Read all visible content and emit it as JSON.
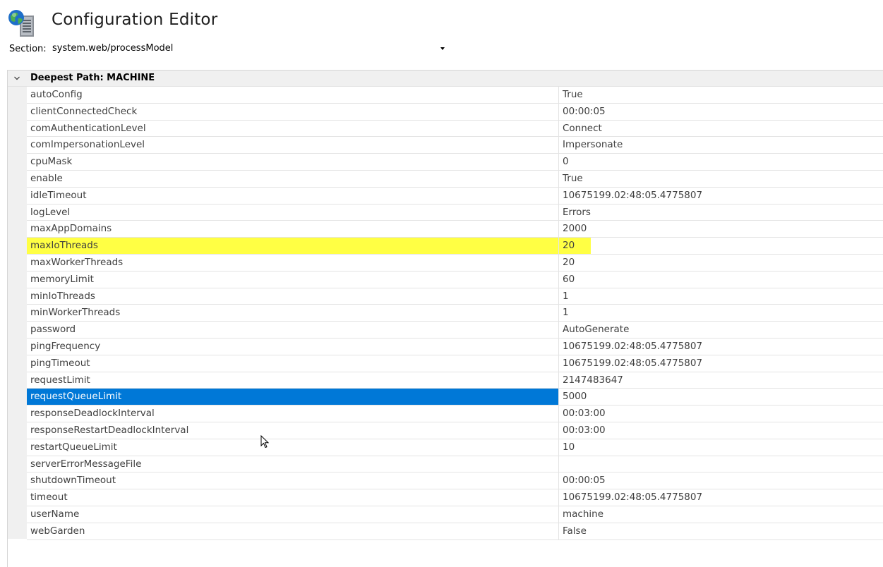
{
  "header": {
    "title": "Configuration Editor",
    "app_icon": "globe-server-icon"
  },
  "section": {
    "label": "Section:",
    "value": "system.web/processModel"
  },
  "group": {
    "title": "Deepest Path: MACHINE",
    "expanded": true
  },
  "colors": {
    "highlight": "#ffff44",
    "selection": "#0078d7"
  },
  "rows": [
    {
      "name": "autoConfig",
      "value": "True"
    },
    {
      "name": "clientConnectedCheck",
      "value": "00:00:05"
    },
    {
      "name": "comAuthenticationLevel",
      "value": "Connect"
    },
    {
      "name": "comImpersonationLevel",
      "value": "Impersonate"
    },
    {
      "name": "cpuMask",
      "value": "0"
    },
    {
      "name": "enable",
      "value": "True"
    },
    {
      "name": "idleTimeout",
      "value": "10675199.02:48:05.4775807"
    },
    {
      "name": "logLevel",
      "value": "Errors"
    },
    {
      "name": "maxAppDomains",
      "value": "2000"
    },
    {
      "name": "maxIoThreads",
      "value": "20",
      "state": "highlight"
    },
    {
      "name": "maxWorkerThreads",
      "value": "20"
    },
    {
      "name": "memoryLimit",
      "value": "60"
    },
    {
      "name": "minIoThreads",
      "value": "1"
    },
    {
      "name": "minWorkerThreads",
      "value": "1"
    },
    {
      "name": "password",
      "value": "AutoGenerate"
    },
    {
      "name": "pingFrequency",
      "value": "10675199.02:48:05.4775807"
    },
    {
      "name": "pingTimeout",
      "value": "10675199.02:48:05.4775807"
    },
    {
      "name": "requestLimit",
      "value": "2147483647"
    },
    {
      "name": "requestQueueLimit",
      "value": "5000",
      "state": "selected"
    },
    {
      "name": "responseDeadlockInterval",
      "value": "00:03:00"
    },
    {
      "name": "responseRestartDeadlockInterval",
      "value": "00:03:00"
    },
    {
      "name": "restartQueueLimit",
      "value": "10"
    },
    {
      "name": "serverErrorMessageFile",
      "value": ""
    },
    {
      "name": "shutdownTimeout",
      "value": "00:00:05"
    },
    {
      "name": "timeout",
      "value": "10675199.02:48:05.4775807"
    },
    {
      "name": "userName",
      "value": "machine"
    },
    {
      "name": "webGarden",
      "value": "False"
    }
  ]
}
